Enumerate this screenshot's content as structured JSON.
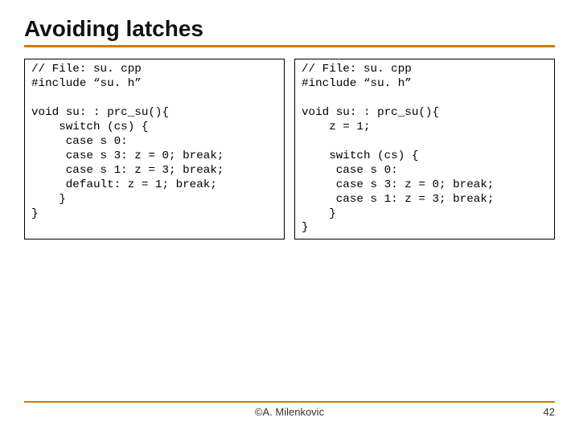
{
  "title": "Avoiding latches",
  "left": {
    "lines": [
      "// File: su. cpp",
      "#include “su. h”",
      "",
      "void su: : prc_su(){",
      "    switch (cs) {",
      "     case s 0:",
      "     case s 3: z = 0; break;",
      "     case s 1: z = 3; break;",
      "     default: z = 1; break;",
      "    }",
      "}"
    ]
  },
  "right": {
    "lines": [
      "// File: su. cpp",
      "#include “su. h”",
      "",
      "void su: : prc_su(){",
      "    z = 1;",
      "",
      "    switch (cs) {",
      "     case s 0:",
      "     case s 3: z = 0; break;",
      "     case s 1: z = 3; break;",
      "    }",
      "}"
    ]
  },
  "footer": {
    "author": "©A. Milenkovic",
    "page": "42"
  }
}
